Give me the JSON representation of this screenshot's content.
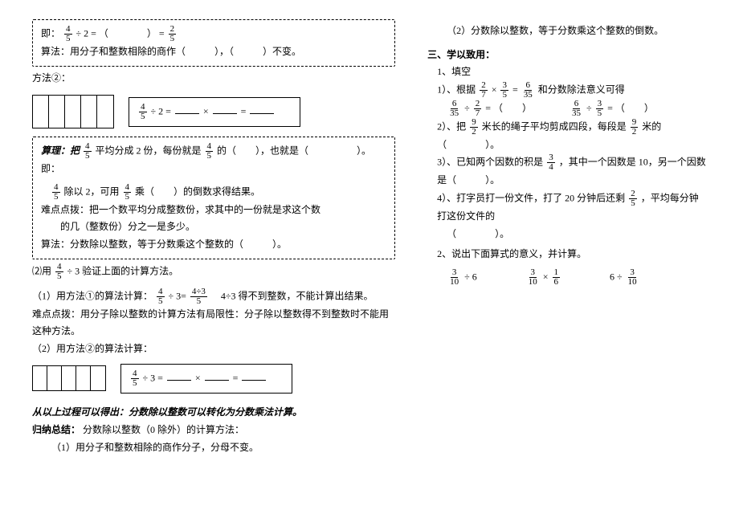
{
  "left": {
    "box1": {
      "line1_pre": "即：",
      "line1_mid": " ÷ 2 = （　　　　） = ",
      "line2": "算法：用分子和整数相除的商作（　　　），（　　　）不变。"
    },
    "method2_label": "方法②：",
    "eq_box1": " ÷ 2 = ",
    "times": " × ",
    "eq_eq": " = ",
    "box2": {
      "l1a": "算理：把",
      "l1b": "平均分成 2 份，每份就是",
      "l1c": "的（　　），也就是（　　　　　）。即：",
      "l2a": "除以 2，可用",
      "l2b": "乘（　　）的倒数求得结果。",
      "l3": "难点点拨：把一个数平均分成整数份，求其中的一份就是求这个数",
      "l3b": "的几（整数份）分之一是多少。",
      "l4": "算法：分数除以整数，等于分数乘这个整数的（　　　）。"
    },
    "verify": "⑵用",
    "verify_b": " ÷ 3 验证上面的计算方法。",
    "m1a": "（1）用方法①的算法计算：",
    "m1b": " ÷ 3=",
    "m1c": "　4÷3 得不到整数，不能计算出结果。",
    "hard": "难点点拨：用分子除以整数的计算方法有局限性：分子除以整数得不到整数时不能用这种方法。",
    "m2": "（2）用方法②的算法计算：",
    "eq_box2": " ÷ 3 = ",
    "concl": "从以上过程可以得出：分数除以整数可以转化为分数乘法计算。",
    "summary_t": "归纳总结：",
    "summary_b": "分数除以整数（0 除外）的计算方法：",
    "s1": "（1）用分子和整数相除的商作分子，分母不变。"
  },
  "right": {
    "r0": "（2）分数除以整数，等于分数乘这个整数的倒数。",
    "h3": "三、学以致用：",
    "h3_1": "1、填空",
    "p1a": "1）、根据 ",
    "p1b": " × ",
    "p1c": " = ",
    "p1d": " 和分数除法意义可得",
    "p1e_a": " ÷ ",
    "p1e_b": " = （　　）",
    "p1e_c": " ÷ ",
    "p1e_d": " = （　　）",
    "p2a": "2）、把",
    "p2b": "米长的绳子平均剪成四段，每段是",
    "p2c": "米的（　　　　）。",
    "p3a": "3）、已知两个因数的积是",
    "p3b": "，其中一个因数是 10，另一个因数是（　　　）。",
    "p4a": "4）、打字员打一份文件，打了 20 分钟后还剩 ",
    "p4b": "，平均每分钟打这份文件的",
    "p4c": "（　　　　）。",
    "h3_2": "2、说出下面算式的意义，并计算。",
    "e1": " ÷ 6",
    "e2": " × ",
    "e3": "6 ÷ "
  },
  "fracs": {
    "f45n": "4",
    "f45d": "5",
    "f25n": "2",
    "f25d": "5",
    "f43n": "4÷3",
    "f43d": "5",
    "f27n": "2",
    "f27d": "7",
    "f35n": "3",
    "f35d": "5",
    "f635n": "6",
    "f635d": "35",
    "f92n": "9",
    "f92d": "2",
    "f34n": "3",
    "f34d": "4",
    "f310n": "3",
    "f310d": "10",
    "f16n": "1",
    "f16d": "6"
  }
}
